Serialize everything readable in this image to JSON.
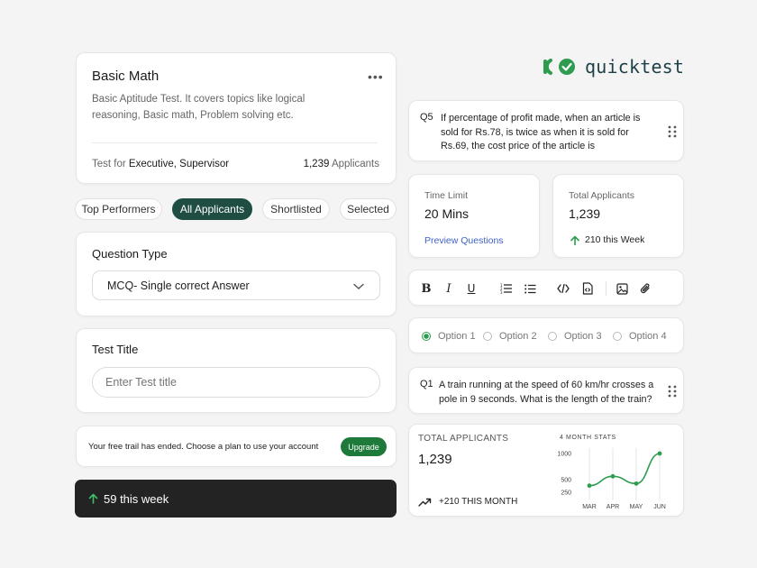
{
  "brand": {
    "name": "quicktest"
  },
  "test_card": {
    "title": "Basic Math",
    "description": "Basic Aptitude Test. It covers topics like logical reasoning, Basic math, Problem solving etc.",
    "test_for_label": "Test for",
    "test_for_value": "Executive, Supervisor",
    "applicants_count": "1,239",
    "applicants_label": "Applicants"
  },
  "filters": [
    {
      "label": "Top Performers",
      "active": false
    },
    {
      "label": "All Applicants",
      "active": true
    },
    {
      "label": "Shortlisted",
      "active": false
    },
    {
      "label": "Selected",
      "active": false
    }
  ],
  "question_type": {
    "label": "Question Type",
    "value": "MCQ- Single correct Answer"
  },
  "test_title": {
    "label": "Test Title",
    "placeholder": "Enter Test title"
  },
  "trial_banner": {
    "message": "Your free trail has ended. Choose a plan to use your account",
    "button": "Upgrade"
  },
  "week_bar": {
    "text": "59 this week"
  },
  "q5": {
    "number": "Q5",
    "text": "If percentage of profit made, when an article is sold for Rs.78, is twice as when it is sold for Rs.69, the cost price of the article is"
  },
  "time_limit": {
    "label": "Time Limit",
    "value": "20 Mins",
    "link": "Preview Questions"
  },
  "total_applicants_card": {
    "label": "Total Applicants",
    "value": "1,239",
    "delta": "210 this Week"
  },
  "toolbar": {
    "buttons": [
      "bold-icon",
      "italic-icon",
      "underline-icon",
      "numbered-list-icon",
      "bullet-list-icon",
      "code-icon",
      "file-code-icon",
      "image-icon",
      "attachment-icon"
    ]
  },
  "options": [
    {
      "label": "Option 1",
      "selected": true
    },
    {
      "label": "Option 2",
      "selected": false
    },
    {
      "label": "Option 3",
      "selected": false
    },
    {
      "label": "Option 4",
      "selected": false
    }
  ],
  "q1": {
    "number": "Q1",
    "text": "A train running at the speed of 60 km/hr crosses a pole in 9 seconds. What is the length of the train?"
  },
  "stats": {
    "label": "TOTAL APPLICANTS",
    "value": "1,239",
    "delta": "+210 THIS MONTH",
    "chart_title": "4 MONTH STATS"
  },
  "chart_data": {
    "type": "line",
    "title": "4 MONTH STATS",
    "categories": [
      "MAR",
      "APR",
      "MAY",
      "JUN"
    ],
    "x": [
      "MAR",
      "APR",
      "MAY",
      "JUN"
    ],
    "series": [
      {
        "values": [
          380,
          560,
          420,
          1000
        ]
      }
    ],
    "y_ticks": [
      1000,
      500,
      250
    ],
    "ylim": [
      200,
      1000
    ],
    "grid": true,
    "color": "#2e9c4f"
  },
  "colors": {
    "accent": "#2e9c4f",
    "dark_green": "#1f4d44",
    "link": "#3f63c9",
    "dark_bar": "#232323"
  }
}
